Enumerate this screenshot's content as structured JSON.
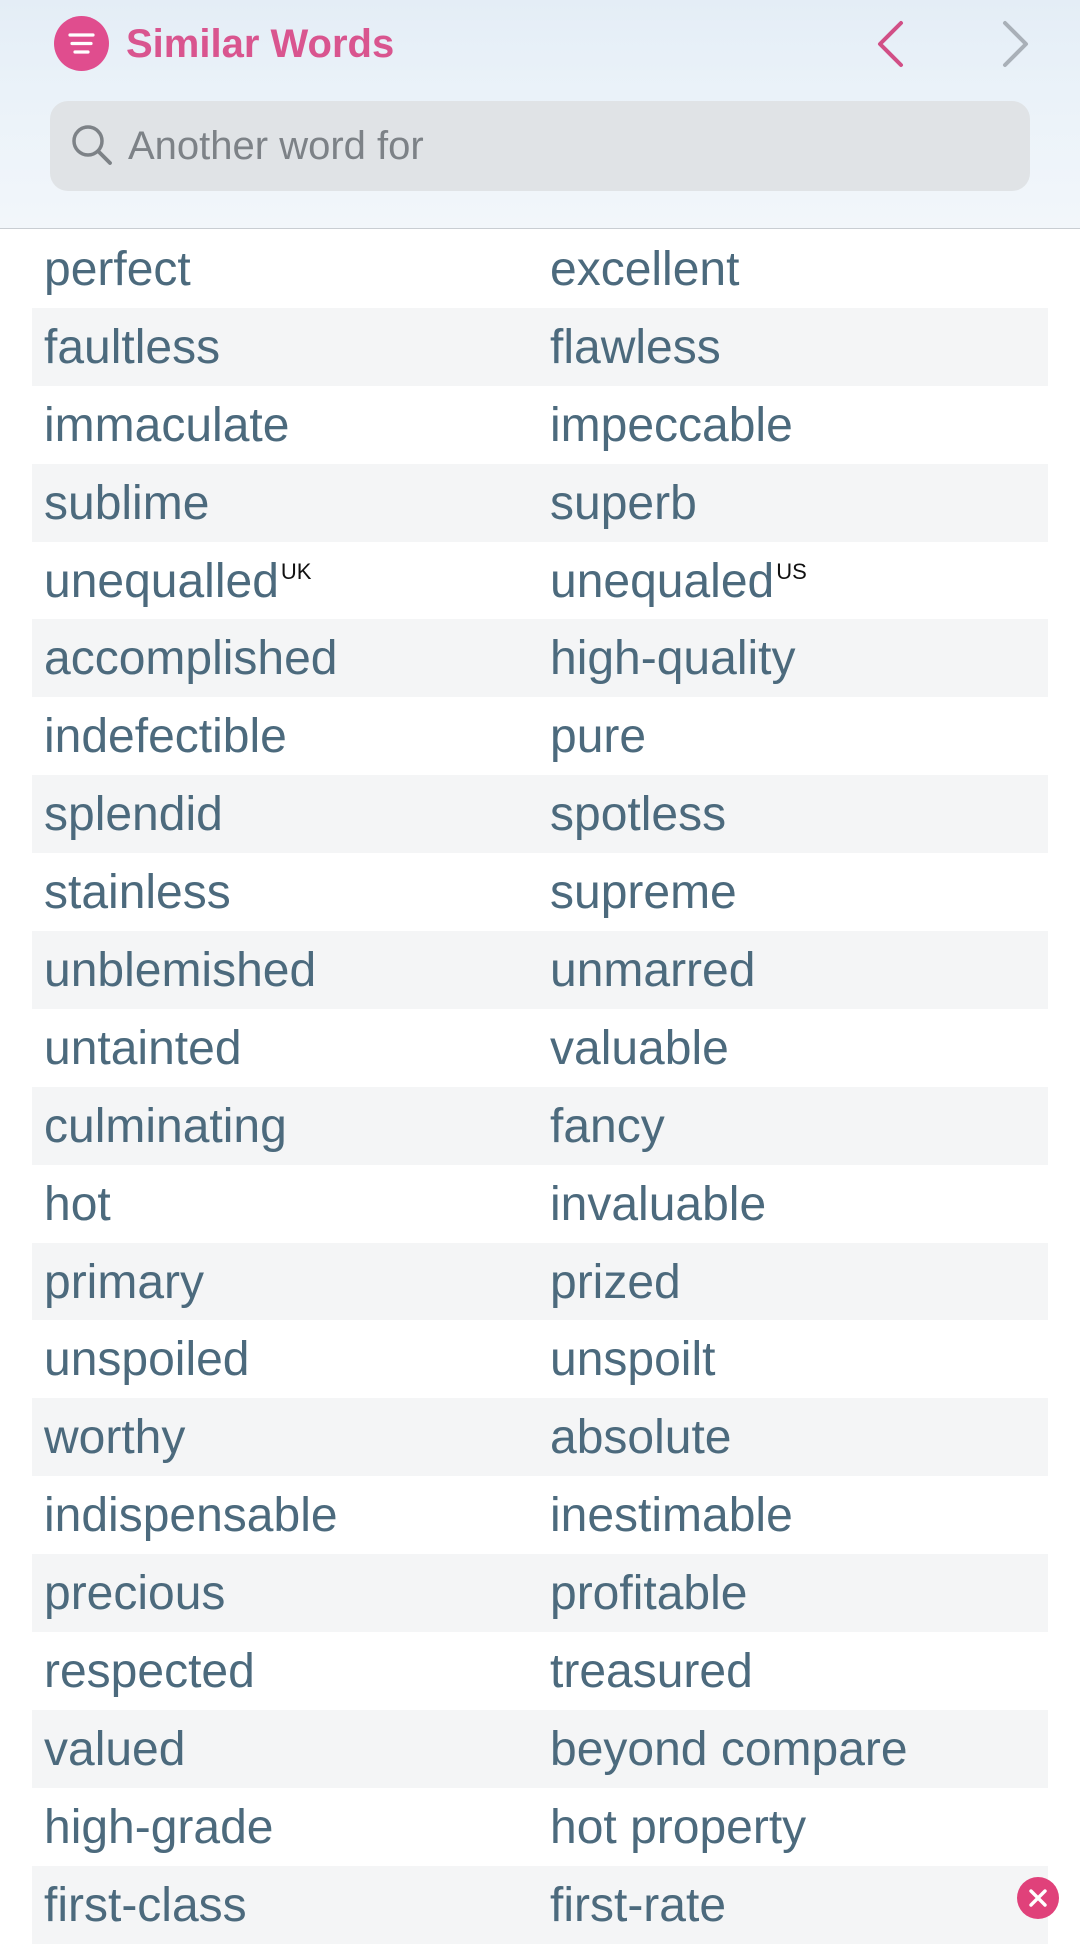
{
  "app": {
    "title": "Similar Words"
  },
  "icons": {
    "menu": "menu-icon",
    "back": "chevron-left-icon",
    "forward": "chevron-right-icon",
    "search": "search-icon",
    "close": "close-icon"
  },
  "colors": {
    "accent": "#e04d8e",
    "title": "#d9558f",
    "word": "#4c6a7d",
    "row_alt": "#f4f5f6",
    "close": "#e0417a"
  },
  "search": {
    "value": "",
    "placeholder": "Another word for"
  },
  "rows": [
    {
      "left": "perfect",
      "right": "excellent"
    },
    {
      "left": "faultless",
      "right": "flawless"
    },
    {
      "left": "immaculate",
      "right": "impeccable"
    },
    {
      "left": "sublime",
      "right": "superb"
    },
    {
      "left": "unequalled",
      "left_tag": "UK",
      "right": "unequaled",
      "right_tag": "US"
    },
    {
      "left": "accomplished",
      "right": "high-quality"
    },
    {
      "left": "indefectible",
      "right": "pure"
    },
    {
      "left": "splendid",
      "right": "spotless"
    },
    {
      "left": "stainless",
      "right": "supreme"
    },
    {
      "left": "unblemished",
      "right": "unmarred"
    },
    {
      "left": "untainted",
      "right": "valuable"
    },
    {
      "left": "culminating",
      "right": "fancy"
    },
    {
      "left": "hot",
      "right": "invaluable"
    },
    {
      "left": "primary",
      "right": "prized"
    },
    {
      "left": "unspoiled",
      "right": "unspoilt"
    },
    {
      "left": "worthy",
      "right": "absolute"
    },
    {
      "left": "indispensable",
      "right": "inestimable"
    },
    {
      "left": "precious",
      "right": "profitable"
    },
    {
      "left": "respected",
      "right": "treasured"
    },
    {
      "left": "valued",
      "right": "beyond compare"
    },
    {
      "left": "high-grade",
      "right": "hot property"
    },
    {
      "left": "first-class",
      "right": "first-rate"
    }
  ]
}
